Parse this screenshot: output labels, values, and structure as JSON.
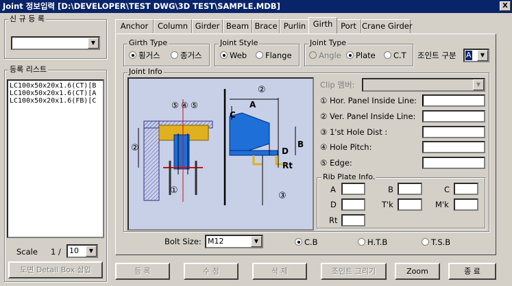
{
  "window": {
    "title": "Joint 정보입력  [D:\\DEVELOPER\\TEST DWG\\3D TEST\\SAMPLE.MDB]",
    "close_label": "X"
  },
  "left": {
    "new_reg_label": "신 규 등 록",
    "new_reg_value": "",
    "reg_list_label": "등록 리스트",
    "reg_list": [
      "LC100x50x20x1.6(CT)[B",
      "LC100x50x20x1.6(CT)[A",
      "LC100x50x20x1.6(FB)[C"
    ],
    "scale_label": "Scale",
    "scale_prefix": "1 /",
    "scale_value": "10",
    "detail_box_btn": "도면 Detail Box 삽입"
  },
  "tabs": [
    "Anchor",
    "Column",
    "Girder",
    "Beam",
    "Brace",
    "Purlin",
    "Girth",
    "Port",
    "Crane Girder"
  ],
  "active_tab": "Girth",
  "girth_type": {
    "label": "Girth Type",
    "opt1": "횡거스",
    "opt2": "종거스",
    "selected": "횡거스"
  },
  "joint_style": {
    "label": "Joint Style",
    "opt1": "Web",
    "opt2": "Flange",
    "selected": "Web"
  },
  "joint_type": {
    "label": "Joint Type",
    "opt1": "Angle",
    "opt2": "Plate",
    "opt3": "C.T",
    "selected": "Plate"
  },
  "joint_div": {
    "label": "조인트 구분",
    "value": "A"
  },
  "joint_info": {
    "label": "Joint Info",
    "clip_label": "Clip 멤버:",
    "clip_value": "",
    "fields": [
      {
        "label": "① Hor. Panel Inside Line:",
        "value": ""
      },
      {
        "label": "② Ver. Panel Inside Line:",
        "value": ""
      },
      {
        "label": "③ 1'st Hole Dist :",
        "value": ""
      },
      {
        "label": "④ Hole Pitch:",
        "value": ""
      },
      {
        "label": "⑤ Edge:",
        "value": ""
      }
    ],
    "rib_label": "Rib Plate Info.",
    "rib": {
      "A": "A",
      "B": "B",
      "C": "C",
      "D": "D",
      "Tk": "T'k",
      "Mk": "M'k",
      "Rt": "Rt"
    }
  },
  "diagram": {
    "n1": "①",
    "n2": "②",
    "n3": "③",
    "n4": "④",
    "n5": "⑤",
    "A": "A",
    "B": "B",
    "C": "C",
    "D": "D",
    "Rt": "Rt"
  },
  "bolt": {
    "label": "Bolt Size:",
    "value": "M12",
    "opt1": "C.B",
    "opt2": "H.T.B",
    "opt3": "T.S.B",
    "selected": "C.B"
  },
  "buttons": {
    "register": "등 록",
    "modify": "수 정",
    "delete": "삭 제",
    "draw": "조인트 그리기",
    "zoom": "Zoom",
    "exit": "종 료"
  },
  "colors": {
    "titlebar": "#0a246a",
    "face": "#d4d0c8",
    "diagram_bg": "#c8d0e8",
    "member_blue": "#1e6fd8",
    "purlin_yellow": "#e0b020",
    "hatch": "#6060b0"
  }
}
